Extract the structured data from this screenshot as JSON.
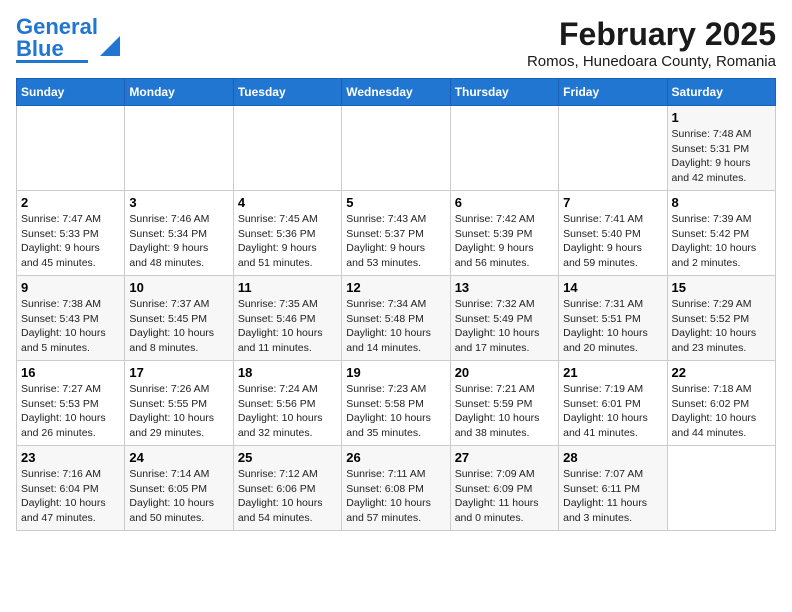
{
  "logo": {
    "line1": "General",
    "line2": "Blue"
  },
  "title": "February 2025",
  "subtitle": "Romos, Hunedoara County, Romania",
  "days_header": [
    "Sunday",
    "Monday",
    "Tuesday",
    "Wednesday",
    "Thursday",
    "Friday",
    "Saturday"
  ],
  "weeks": [
    [
      {
        "num": "",
        "info": ""
      },
      {
        "num": "",
        "info": ""
      },
      {
        "num": "",
        "info": ""
      },
      {
        "num": "",
        "info": ""
      },
      {
        "num": "",
        "info": ""
      },
      {
        "num": "",
        "info": ""
      },
      {
        "num": "1",
        "info": "Sunrise: 7:48 AM\nSunset: 5:31 PM\nDaylight: 9 hours\nand 42 minutes."
      }
    ],
    [
      {
        "num": "2",
        "info": "Sunrise: 7:47 AM\nSunset: 5:33 PM\nDaylight: 9 hours\nand 45 minutes."
      },
      {
        "num": "3",
        "info": "Sunrise: 7:46 AM\nSunset: 5:34 PM\nDaylight: 9 hours\nand 48 minutes."
      },
      {
        "num": "4",
        "info": "Sunrise: 7:45 AM\nSunset: 5:36 PM\nDaylight: 9 hours\nand 51 minutes."
      },
      {
        "num": "5",
        "info": "Sunrise: 7:43 AM\nSunset: 5:37 PM\nDaylight: 9 hours\nand 53 minutes."
      },
      {
        "num": "6",
        "info": "Sunrise: 7:42 AM\nSunset: 5:39 PM\nDaylight: 9 hours\nand 56 minutes."
      },
      {
        "num": "7",
        "info": "Sunrise: 7:41 AM\nSunset: 5:40 PM\nDaylight: 9 hours\nand 59 minutes."
      },
      {
        "num": "8",
        "info": "Sunrise: 7:39 AM\nSunset: 5:42 PM\nDaylight: 10 hours\nand 2 minutes."
      }
    ],
    [
      {
        "num": "9",
        "info": "Sunrise: 7:38 AM\nSunset: 5:43 PM\nDaylight: 10 hours\nand 5 minutes."
      },
      {
        "num": "10",
        "info": "Sunrise: 7:37 AM\nSunset: 5:45 PM\nDaylight: 10 hours\nand 8 minutes."
      },
      {
        "num": "11",
        "info": "Sunrise: 7:35 AM\nSunset: 5:46 PM\nDaylight: 10 hours\nand 11 minutes."
      },
      {
        "num": "12",
        "info": "Sunrise: 7:34 AM\nSunset: 5:48 PM\nDaylight: 10 hours\nand 14 minutes."
      },
      {
        "num": "13",
        "info": "Sunrise: 7:32 AM\nSunset: 5:49 PM\nDaylight: 10 hours\nand 17 minutes."
      },
      {
        "num": "14",
        "info": "Sunrise: 7:31 AM\nSunset: 5:51 PM\nDaylight: 10 hours\nand 20 minutes."
      },
      {
        "num": "15",
        "info": "Sunrise: 7:29 AM\nSunset: 5:52 PM\nDaylight: 10 hours\nand 23 minutes."
      }
    ],
    [
      {
        "num": "16",
        "info": "Sunrise: 7:27 AM\nSunset: 5:53 PM\nDaylight: 10 hours\nand 26 minutes."
      },
      {
        "num": "17",
        "info": "Sunrise: 7:26 AM\nSunset: 5:55 PM\nDaylight: 10 hours\nand 29 minutes."
      },
      {
        "num": "18",
        "info": "Sunrise: 7:24 AM\nSunset: 5:56 PM\nDaylight: 10 hours\nand 32 minutes."
      },
      {
        "num": "19",
        "info": "Sunrise: 7:23 AM\nSunset: 5:58 PM\nDaylight: 10 hours\nand 35 minutes."
      },
      {
        "num": "20",
        "info": "Sunrise: 7:21 AM\nSunset: 5:59 PM\nDaylight: 10 hours\nand 38 minutes."
      },
      {
        "num": "21",
        "info": "Sunrise: 7:19 AM\nSunset: 6:01 PM\nDaylight: 10 hours\nand 41 minutes."
      },
      {
        "num": "22",
        "info": "Sunrise: 7:18 AM\nSunset: 6:02 PM\nDaylight: 10 hours\nand 44 minutes."
      }
    ],
    [
      {
        "num": "23",
        "info": "Sunrise: 7:16 AM\nSunset: 6:04 PM\nDaylight: 10 hours\nand 47 minutes."
      },
      {
        "num": "24",
        "info": "Sunrise: 7:14 AM\nSunset: 6:05 PM\nDaylight: 10 hours\nand 50 minutes."
      },
      {
        "num": "25",
        "info": "Sunrise: 7:12 AM\nSunset: 6:06 PM\nDaylight: 10 hours\nand 54 minutes."
      },
      {
        "num": "26",
        "info": "Sunrise: 7:11 AM\nSunset: 6:08 PM\nDaylight: 10 hours\nand 57 minutes."
      },
      {
        "num": "27",
        "info": "Sunrise: 7:09 AM\nSunset: 6:09 PM\nDaylight: 11 hours\nand 0 minutes."
      },
      {
        "num": "28",
        "info": "Sunrise: 7:07 AM\nSunset: 6:11 PM\nDaylight: 11 hours\nand 3 minutes."
      },
      {
        "num": "",
        "info": ""
      }
    ]
  ]
}
